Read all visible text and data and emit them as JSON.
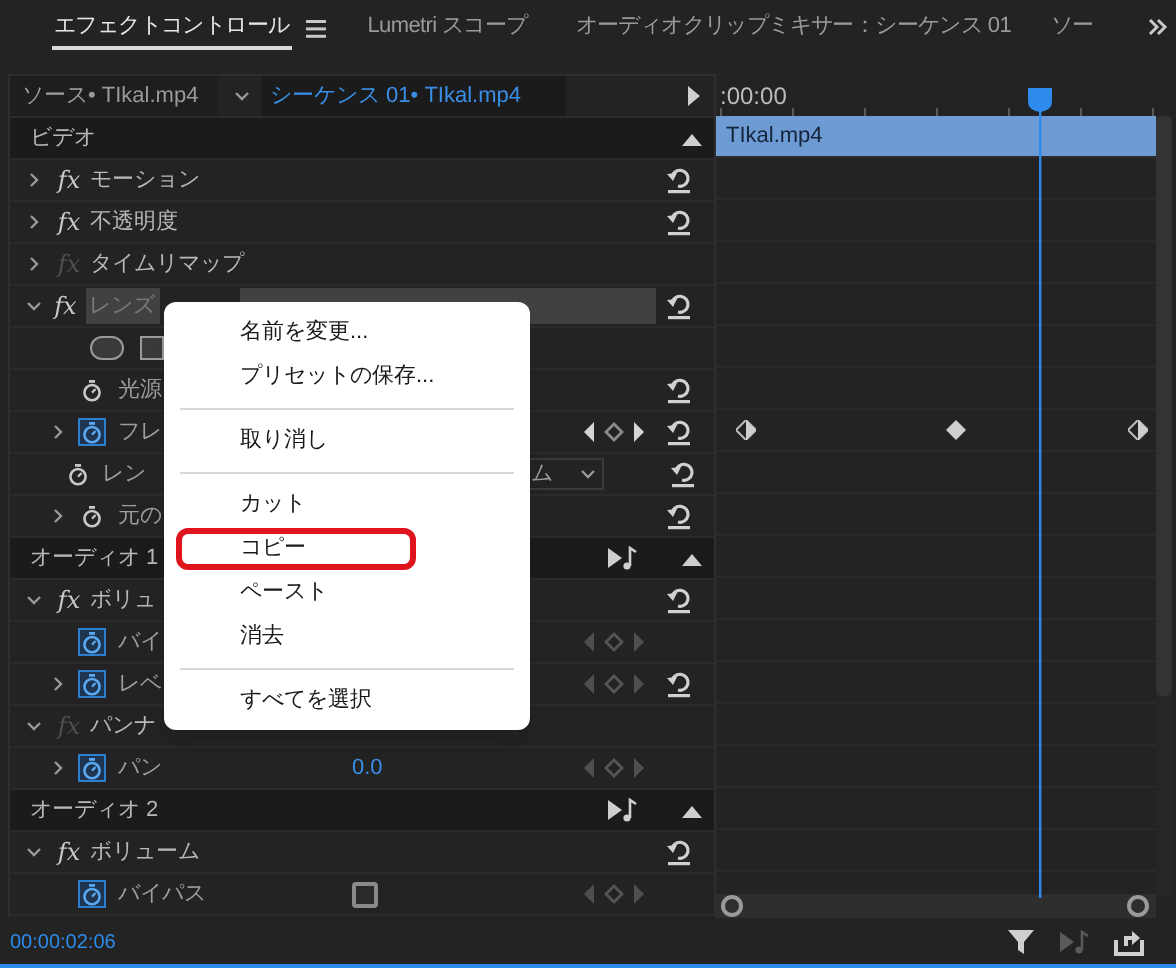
{
  "tabs": [
    {
      "label": "エフェクトコントロール",
      "selected": true,
      "menu": true
    },
    {
      "label": "Lumetri スコープ",
      "selected": false,
      "menu": false
    },
    {
      "label": "オーディオクリップミキサー：シーケンス 01",
      "selected": false,
      "menu": false
    },
    {
      "label": "ソー",
      "selected": false,
      "menu": false
    }
  ],
  "header": {
    "source": "ソース• TIkal.mp4",
    "sequence": "シーケンス 01• TIkal.mp4"
  },
  "rows": [
    {
      "kind": "section",
      "label": "ビデオ",
      "audio_button": false
    },
    {
      "kind": "effect",
      "label": "モーション",
      "badge": "fx",
      "expanded": false,
      "enabled": true,
      "reset": true,
      "highlighted": false
    },
    {
      "kind": "effect",
      "label": "不透明度",
      "badge": "fx",
      "expanded": false,
      "enabled": true,
      "reset": true,
      "highlighted": false
    },
    {
      "kind": "effect",
      "label": "タイムリマップ",
      "badge": "fx",
      "expanded": false,
      "enabled": false,
      "reset": false,
      "highlighted": false
    },
    {
      "kind": "effect",
      "label": "レンズ",
      "badge": "fx",
      "expanded": true,
      "enabled": true,
      "reset": true,
      "highlighted": true
    },
    {
      "kind": "shapes"
    },
    {
      "kind": "param",
      "label": "光源",
      "expandable": false,
      "animated": false,
      "keyframes": false,
      "reset": true
    },
    {
      "kind": "param",
      "label": "フレ",
      "expandable": true,
      "animated": true,
      "keyframes": true,
      "nav_enabled": true,
      "reset": true
    },
    {
      "kind": "param",
      "label": "レン",
      "expandable": false,
      "animated": false,
      "keyframes": false,
      "reset": true,
      "dropdown": "ム"
    },
    {
      "kind": "param",
      "label": "元の",
      "expandable": true,
      "animated": false,
      "keyframes": false,
      "reset": true
    },
    {
      "kind": "section",
      "label": "オーディオ 1",
      "audio_button": true
    },
    {
      "kind": "effect",
      "label": "ボリュ",
      "badge": "fx",
      "expanded": true,
      "enabled": true,
      "reset": true,
      "highlighted": false
    },
    {
      "kind": "param",
      "label": "バイ",
      "expandable": false,
      "animated": true,
      "keyframes": true,
      "nav_enabled": false,
      "reset": false
    },
    {
      "kind": "param",
      "label": "レベ",
      "expandable": true,
      "animated": true,
      "keyframes": true,
      "nav_enabled": false,
      "reset": true
    },
    {
      "kind": "effect",
      "label": "パンナ",
      "badge": "fx",
      "expanded": true,
      "enabled": false,
      "reset": false,
      "highlighted": false
    },
    {
      "kind": "param",
      "label": "パン",
      "expandable": true,
      "animated": true,
      "keyframes": true,
      "nav_enabled": false,
      "reset": false,
      "value": "0.0"
    },
    {
      "kind": "section",
      "label": "オーディオ 2",
      "audio_button": true
    },
    {
      "kind": "effect",
      "label": "ボリューム",
      "badge": "fx",
      "expanded": true,
      "enabled": true,
      "reset": true,
      "highlighted": false
    },
    {
      "kind": "param",
      "label": "バイパス",
      "expandable": false,
      "animated": true,
      "keyframes": true,
      "nav_enabled": false,
      "reset": false,
      "checkbox": false
    }
  ],
  "timeline": {
    "timecode": ":00:00",
    "clip": "TIkal.mp4"
  },
  "current_time": "00:00:02:06",
  "context_menu": [
    {
      "kind": "item",
      "label": "名前を変更...",
      "marked": false
    },
    {
      "kind": "item",
      "label": "プリセットの保存...",
      "marked": false
    },
    {
      "kind": "divider"
    },
    {
      "kind": "item",
      "label": "取り消し",
      "marked": false
    },
    {
      "kind": "divider"
    },
    {
      "kind": "item",
      "label": "カット",
      "marked": false
    },
    {
      "kind": "item",
      "label": "コピー",
      "marked": true
    },
    {
      "kind": "item",
      "label": "ペースト",
      "marked": false
    },
    {
      "kind": "item",
      "label": "消去",
      "marked": false
    },
    {
      "kind": "divider"
    },
    {
      "kind": "item",
      "label": "すべてを選択",
      "marked": false
    }
  ]
}
